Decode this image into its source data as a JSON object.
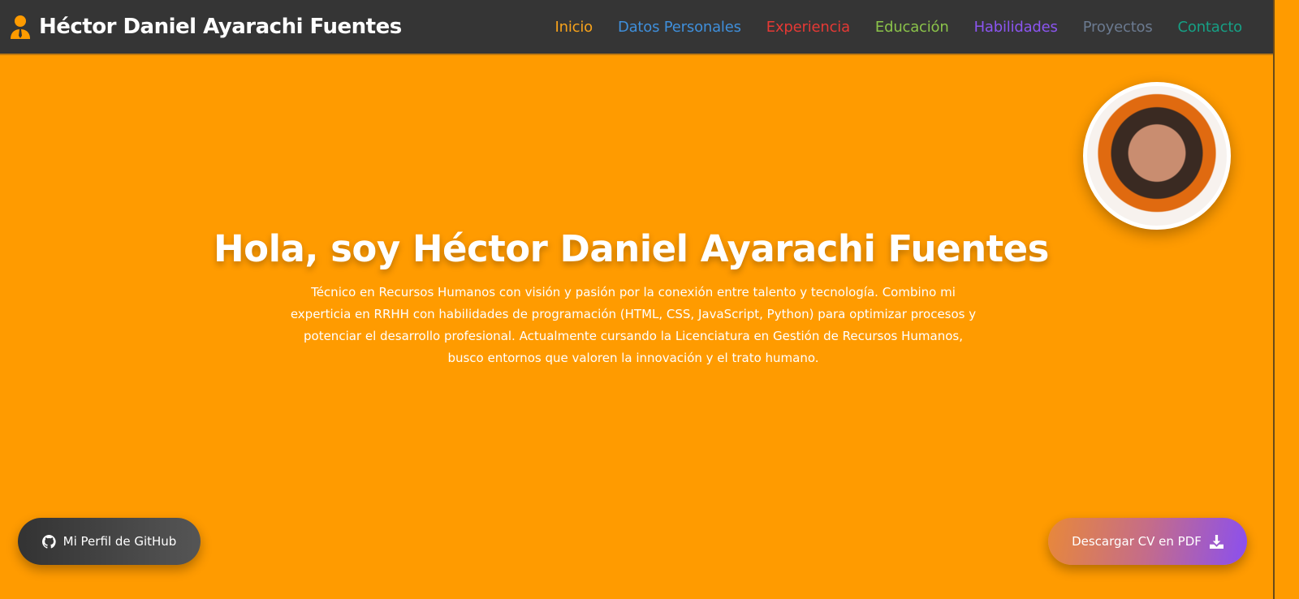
{
  "header": {
    "brand": "Héctor Daniel Ayarachi Fuentes",
    "icon": "user-tie-icon",
    "nav": [
      {
        "label": "Inicio",
        "color": "#f7a21b"
      },
      {
        "label": "Datos Personales",
        "color": "#3f8fdb"
      },
      {
        "label": "Experiencia",
        "color": "#e53935"
      },
      {
        "label": "Educación",
        "color": "#8bc34a"
      },
      {
        "label": "Habilidades",
        "color": "#8b55f0"
      },
      {
        "label": "Proyectos",
        "color": "#6b7a90"
      },
      {
        "label": "Contacto",
        "color": "#16a085"
      }
    ]
  },
  "hero": {
    "title": "Hola, soy Héctor Daniel Ayarachi Fuentes",
    "description": "Técnico en Recursos Humanos con visión y pasión por la conexión entre talento y tecnología. Combino mi experticia en RRHH con habilidades de programación (HTML, CSS, JavaScript, Python) para optimizar procesos y potenciar el desarrollo profesional. Actualmente cursando la Licenciatura en Gestión de Recursos Humanos, busco entornos que valoren la innovación y el trato humano."
  },
  "buttons": {
    "github": "Mi Perfil de GitHub",
    "cv": "Descargar CV en PDF"
  }
}
